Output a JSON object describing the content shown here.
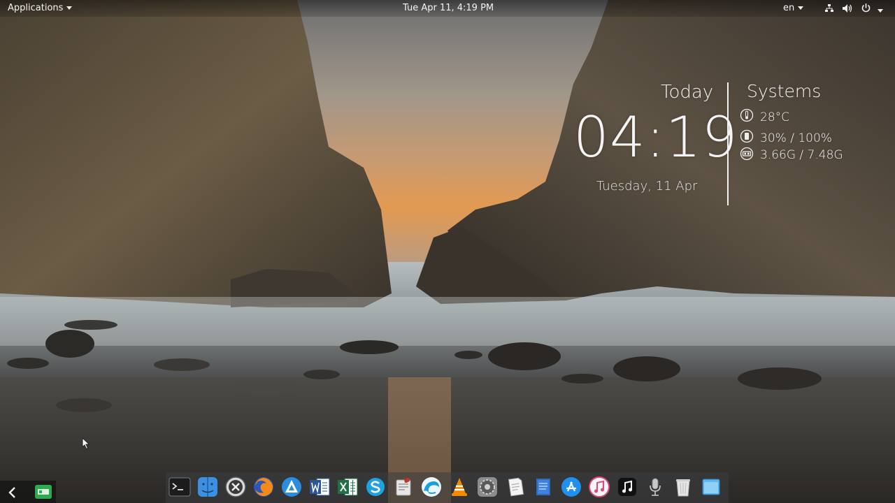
{
  "topbar": {
    "applications_label": "Applications",
    "datetime": "Tue Apr 11,  4:19 PM",
    "language": "en"
  },
  "widget": {
    "today_label": "Today",
    "time": "04:19",
    "date": "Tuesday, 11 Apr",
    "systems_label": "Systems",
    "temperature": "28°C",
    "battery": "30% / 100%",
    "memory": "3.66G / 7.48G"
  },
  "dock": {
    "icons": [
      "terminal-icon",
      "finder-icon",
      "launchpad-icon",
      "firefox-icon",
      "appstore-alt-icon",
      "word-icon",
      "excel-icon",
      "skype-icon",
      "script-editor-icon",
      "browser-wave-icon",
      "vlc-icon",
      "system-preferences-icon",
      "text-editor-icon",
      "notes-icon",
      "app-store-icon",
      "itunes-icon",
      "music-icon",
      "voice-recorder-icon",
      "trash-icon",
      "desktop-folder-icon"
    ]
  },
  "tray": {
    "icons": [
      "back-arrow-icon",
      "screen-recorder-icon"
    ]
  },
  "colors": {
    "panel_bg": "#1f1f1f",
    "widget_text": "#f4f4f4",
    "dock_bg": "#3c3e42"
  }
}
